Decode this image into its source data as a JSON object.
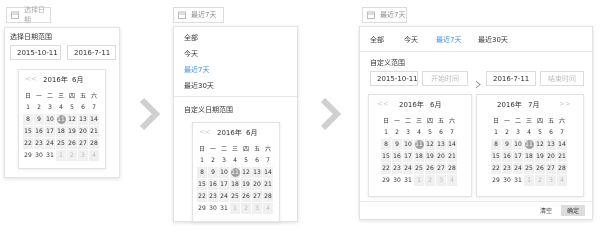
{
  "panel1": {
    "trigger_text": "选择日期",
    "title": "选择日期范围",
    "start": "2015-10-11",
    "end": "2016-7-11",
    "cal": {
      "nav_prev": "<<",
      "year": "2016年",
      "month": "6月"
    }
  },
  "panel2": {
    "trigger_text": "最近7天",
    "menu": [
      "全部",
      "今天",
      "最近7天",
      "最近30天"
    ],
    "custom_title": "自定义日期范围",
    "cal": {
      "nav_prev": "<<",
      "year": "2016年",
      "month": "6月"
    }
  },
  "panel3": {
    "trigger_text": "最近7天",
    "tabs": [
      "全部",
      "今天",
      "最近7天",
      "最近30天"
    ],
    "custom_title": "自定义范围",
    "start_value": "2015-10-11",
    "start_placeholder": "开始时间",
    "end_value": "2016-7-11",
    "end_placeholder": "结束时间",
    "cal_left": {
      "nav_prev": "<<",
      "year": "2016年",
      "month": "6月"
    },
    "cal_right": {
      "year": "2016年",
      "month": "7月",
      "nav_next": ">>"
    },
    "clear_label": "清空",
    "ok_label": "确定"
  },
  "weekdays": [
    "日",
    "一",
    "二",
    "三",
    "四",
    "五",
    "六"
  ],
  "days": [
    "1",
    "2",
    "3",
    "4",
    "5",
    "6",
    "7",
    "8",
    "9",
    "10",
    "11",
    "12",
    "13",
    "14",
    "15",
    "16",
    "17",
    "18",
    "19",
    "20",
    "21",
    "22",
    "23",
    "24",
    "25",
    "26",
    "27",
    "28",
    "29",
    "30",
    "31",
    "1",
    "2",
    "3",
    "4"
  ],
  "today_index": 10,
  "colors": {
    "accent": "#3a8ee6",
    "today": "#9e9e9e",
    "shade": "#f0f0f0",
    "arrow": "#d0d0d0"
  }
}
